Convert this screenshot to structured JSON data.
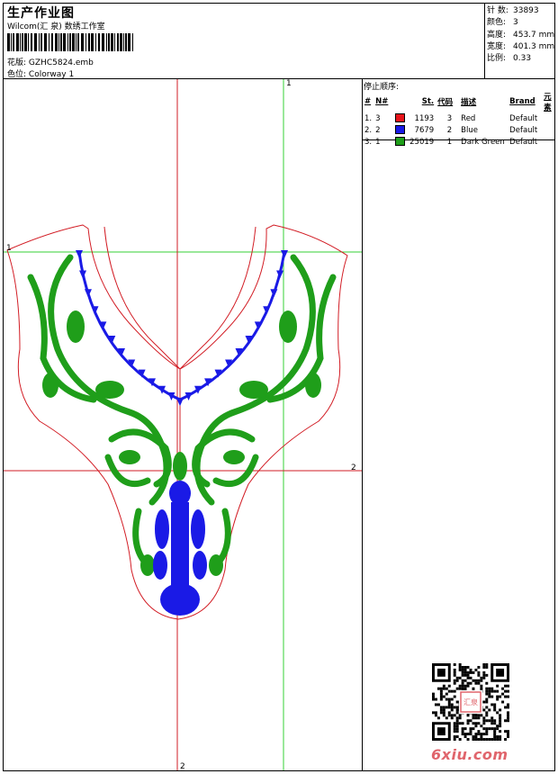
{
  "header": {
    "title": "生产作业图",
    "subtitle": "Wilcom(汇 泉) 数绣工作室",
    "design_label": "花版:",
    "design_value": "GZHC5824.emb",
    "colorway_label": "色位:",
    "colorway_value": "Colorway 1"
  },
  "stats": [
    {
      "label": "针 数:",
      "value": "33893"
    },
    {
      "label": "颜色:",
      "value": "3"
    },
    {
      "label": "高度:",
      "value": "453.7 mm"
    },
    {
      "label": "宽度:",
      "value": "401.3 mm"
    },
    {
      "label": "比例:",
      "value": "0.33"
    }
  ],
  "stop_sequence": {
    "title": "停止顺序:",
    "headers": [
      "#",
      "N#",
      "",
      "St.",
      "代码",
      "描述",
      "Brand",
      "元素"
    ],
    "rows": [
      {
        "num": "1.",
        "n": "3",
        "color": "#e8141b",
        "st": "1193",
        "code": "3",
        "desc": "Red",
        "brand": "Default"
      },
      {
        "num": "2.",
        "n": "2",
        "color": "#1a1ae6",
        "st": "7679",
        "code": "2",
        "desc": "Blue",
        "brand": "Default"
      },
      {
        "num": "3.",
        "n": "1",
        "color": "#1f9e1a",
        "st": "25019",
        "code": "1",
        "desc": "Dark Green",
        "brand": "Default"
      }
    ]
  },
  "axes": {
    "green_v": "1",
    "green_h": "1",
    "red_h": "2",
    "red_v": "2"
  },
  "colors": {
    "red": "#d21c24",
    "blue": "#1a1ae6",
    "green": "#1f9e1a",
    "guide_green": "#35d135",
    "brand": "#e0656c"
  },
  "watermark": {
    "brand": "6xiu.com",
    "seal": "汇泉"
  }
}
